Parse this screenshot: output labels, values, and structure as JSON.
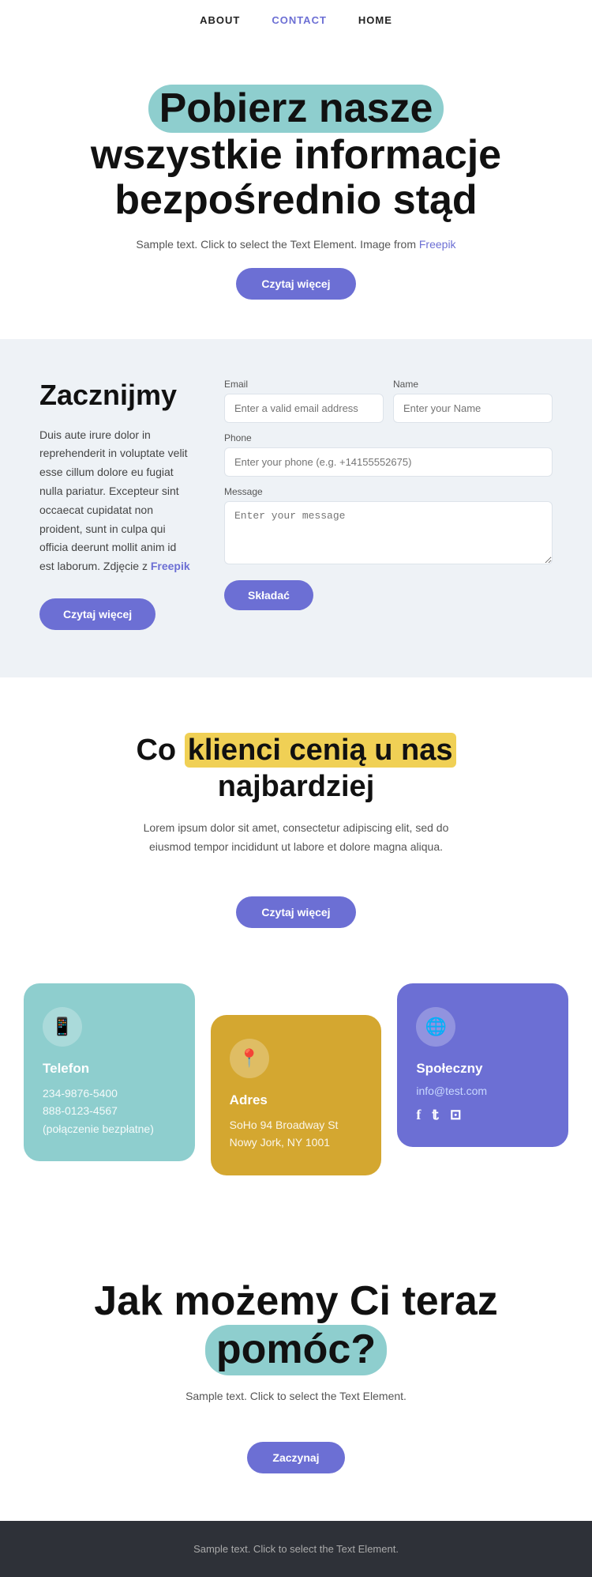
{
  "nav": {
    "items": [
      {
        "label": "ABOUT",
        "href": "#",
        "active": false
      },
      {
        "label": "CONTACT",
        "href": "#",
        "active": true
      },
      {
        "label": "HOME",
        "href": "#",
        "active": false
      }
    ]
  },
  "hero": {
    "heading_highlight": "Pobierz nasze",
    "heading_rest": "wszystkie informacje bezpośrednio stąd",
    "subtext": "Sample text. Click to select the Text Element. Image from",
    "subtext_link": "Freepik",
    "button": "Czytaj więcej"
  },
  "contact": {
    "heading": "Zacznijmy",
    "paragraph": "Duis aute irure dolor in reprehenderit in voluptate velit esse cillum dolore eu fugiat nulla pariatur. Excepteur sint occaecat cupidatat non proident, sunt in culpa qui officia deerunt mollit anim id est laborum. Zdjęcie z",
    "paragraph_link": "Freepik",
    "button": "Czytaj więcej",
    "form": {
      "email_label": "Email",
      "email_placeholder": "Enter a valid email address",
      "name_label": "Name",
      "name_placeholder": "Enter your Name",
      "phone_label": "Phone",
      "phone_placeholder": "Enter your phone (e.g. +14155552675)",
      "message_label": "Message",
      "message_placeholder": "Enter your message",
      "submit": "Składać"
    }
  },
  "clients": {
    "heading_before": "Co ",
    "heading_highlight": "klienci cenią u nas",
    "heading_after": " najbardziej",
    "paragraph": "Lorem ipsum dolor sit amet, consectetur adipiscing elit, sed do eiusmod tempor incididunt ut labore et dolore magna aliqua.",
    "button": "Czytaj więcej"
  },
  "cards": [
    {
      "icon": "📱",
      "title": "Telefon",
      "lines": [
        "234-9876-5400",
        "888-0123-4567 (połączenie bezpłatne)"
      ],
      "type": "teal"
    },
    {
      "icon": "📍",
      "title": "Adres",
      "lines": [
        "SoHo 94 Broadway St Nowy Jork, NY 1001"
      ],
      "type": "yellow"
    },
    {
      "icon": "🌐",
      "title": "Społeczny",
      "email": "info@test.com",
      "social": [
        "f",
        "𝕥",
        "📷"
      ],
      "type": "purple"
    }
  ],
  "help": {
    "heading_before": "Jak możemy Ci teraz",
    "heading_highlight": "pomóc?",
    "subtext": "Sample text. Click to select the Text Element.",
    "button": "Zaczynaj"
  },
  "footer": {
    "text": "Sample text. Click to select the Text Element."
  }
}
